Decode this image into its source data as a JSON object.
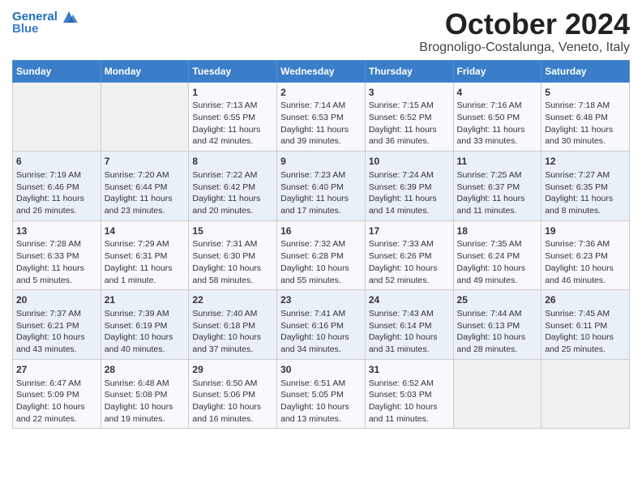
{
  "header": {
    "logo_line1": "General",
    "logo_line2": "Blue",
    "month": "October 2024",
    "location": "Brognoligo-Costalunga, Veneto, Italy"
  },
  "days_of_week": [
    "Sunday",
    "Monday",
    "Tuesday",
    "Wednesday",
    "Thursday",
    "Friday",
    "Saturday"
  ],
  "weeks": [
    [
      {
        "day": "",
        "info": ""
      },
      {
        "day": "",
        "info": ""
      },
      {
        "day": "1",
        "info": "Sunrise: 7:13 AM\nSunset: 6:55 PM\nDaylight: 11 hours and 42 minutes."
      },
      {
        "day": "2",
        "info": "Sunrise: 7:14 AM\nSunset: 6:53 PM\nDaylight: 11 hours and 39 minutes."
      },
      {
        "day": "3",
        "info": "Sunrise: 7:15 AM\nSunset: 6:52 PM\nDaylight: 11 hours and 36 minutes."
      },
      {
        "day": "4",
        "info": "Sunrise: 7:16 AM\nSunset: 6:50 PM\nDaylight: 11 hours and 33 minutes."
      },
      {
        "day": "5",
        "info": "Sunrise: 7:18 AM\nSunset: 6:48 PM\nDaylight: 11 hours and 30 minutes."
      }
    ],
    [
      {
        "day": "6",
        "info": "Sunrise: 7:19 AM\nSunset: 6:46 PM\nDaylight: 11 hours and 26 minutes."
      },
      {
        "day": "7",
        "info": "Sunrise: 7:20 AM\nSunset: 6:44 PM\nDaylight: 11 hours and 23 minutes."
      },
      {
        "day": "8",
        "info": "Sunrise: 7:22 AM\nSunset: 6:42 PM\nDaylight: 11 hours and 20 minutes."
      },
      {
        "day": "9",
        "info": "Sunrise: 7:23 AM\nSunset: 6:40 PM\nDaylight: 11 hours and 17 minutes."
      },
      {
        "day": "10",
        "info": "Sunrise: 7:24 AM\nSunset: 6:39 PM\nDaylight: 11 hours and 14 minutes."
      },
      {
        "day": "11",
        "info": "Sunrise: 7:25 AM\nSunset: 6:37 PM\nDaylight: 11 hours and 11 minutes."
      },
      {
        "day": "12",
        "info": "Sunrise: 7:27 AM\nSunset: 6:35 PM\nDaylight: 11 hours and 8 minutes."
      }
    ],
    [
      {
        "day": "13",
        "info": "Sunrise: 7:28 AM\nSunset: 6:33 PM\nDaylight: 11 hours and 5 minutes."
      },
      {
        "day": "14",
        "info": "Sunrise: 7:29 AM\nSunset: 6:31 PM\nDaylight: 11 hours and 1 minute."
      },
      {
        "day": "15",
        "info": "Sunrise: 7:31 AM\nSunset: 6:30 PM\nDaylight: 10 hours and 58 minutes."
      },
      {
        "day": "16",
        "info": "Sunrise: 7:32 AM\nSunset: 6:28 PM\nDaylight: 10 hours and 55 minutes."
      },
      {
        "day": "17",
        "info": "Sunrise: 7:33 AM\nSunset: 6:26 PM\nDaylight: 10 hours and 52 minutes."
      },
      {
        "day": "18",
        "info": "Sunrise: 7:35 AM\nSunset: 6:24 PM\nDaylight: 10 hours and 49 minutes."
      },
      {
        "day": "19",
        "info": "Sunrise: 7:36 AM\nSunset: 6:23 PM\nDaylight: 10 hours and 46 minutes."
      }
    ],
    [
      {
        "day": "20",
        "info": "Sunrise: 7:37 AM\nSunset: 6:21 PM\nDaylight: 10 hours and 43 minutes."
      },
      {
        "day": "21",
        "info": "Sunrise: 7:39 AM\nSunset: 6:19 PM\nDaylight: 10 hours and 40 minutes."
      },
      {
        "day": "22",
        "info": "Sunrise: 7:40 AM\nSunset: 6:18 PM\nDaylight: 10 hours and 37 minutes."
      },
      {
        "day": "23",
        "info": "Sunrise: 7:41 AM\nSunset: 6:16 PM\nDaylight: 10 hours and 34 minutes."
      },
      {
        "day": "24",
        "info": "Sunrise: 7:43 AM\nSunset: 6:14 PM\nDaylight: 10 hours and 31 minutes."
      },
      {
        "day": "25",
        "info": "Sunrise: 7:44 AM\nSunset: 6:13 PM\nDaylight: 10 hours and 28 minutes."
      },
      {
        "day": "26",
        "info": "Sunrise: 7:45 AM\nSunset: 6:11 PM\nDaylight: 10 hours and 25 minutes."
      }
    ],
    [
      {
        "day": "27",
        "info": "Sunrise: 6:47 AM\nSunset: 5:09 PM\nDaylight: 10 hours and 22 minutes."
      },
      {
        "day": "28",
        "info": "Sunrise: 6:48 AM\nSunset: 5:08 PM\nDaylight: 10 hours and 19 minutes."
      },
      {
        "day": "29",
        "info": "Sunrise: 6:50 AM\nSunset: 5:06 PM\nDaylight: 10 hours and 16 minutes."
      },
      {
        "day": "30",
        "info": "Sunrise: 6:51 AM\nSunset: 5:05 PM\nDaylight: 10 hours and 13 minutes."
      },
      {
        "day": "31",
        "info": "Sunrise: 6:52 AM\nSunset: 5:03 PM\nDaylight: 10 hours and 11 minutes."
      },
      {
        "day": "",
        "info": ""
      },
      {
        "day": "",
        "info": ""
      }
    ]
  ]
}
